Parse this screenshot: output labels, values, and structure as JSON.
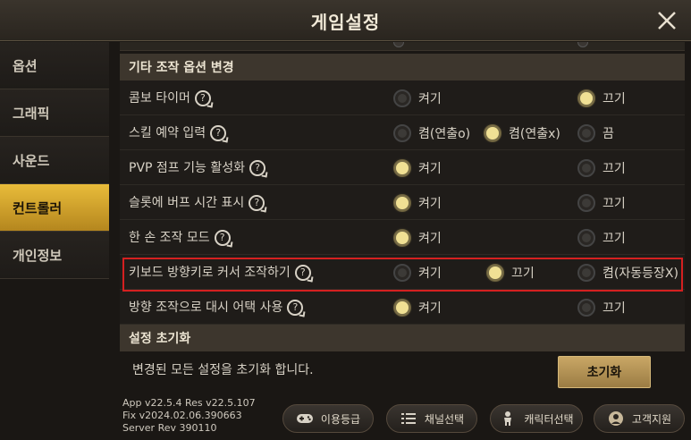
{
  "header": {
    "title": "게임설정"
  },
  "sidebar": {
    "items": [
      {
        "label": "옵션",
        "active": false
      },
      {
        "label": "그래픽",
        "active": false
      },
      {
        "label": "사운드",
        "active": false
      },
      {
        "label": "컨트롤러",
        "active": true
      },
      {
        "label": "개인정보",
        "active": false
      }
    ]
  },
  "sections": {
    "other_controls": "기타 조작 옵션 변경",
    "reset": "설정 초기화"
  },
  "rows": [
    {
      "label": "콤보 타이머",
      "options": [
        {
          "label": "켜기",
          "selected": false
        },
        {
          "label": "끄기",
          "selected": true
        }
      ]
    },
    {
      "label": "스킬 예약 입력",
      "options": [
        {
          "label": "켬(연출o)",
          "selected": false
        },
        {
          "label": "켬(연출x)",
          "selected": true
        },
        {
          "label": "끔",
          "selected": false
        }
      ]
    },
    {
      "label": "PVP 점프 기능 활성화",
      "options": [
        {
          "label": "켜기",
          "selected": true
        },
        {
          "label": "끄기",
          "selected": false
        }
      ]
    },
    {
      "label": "슬롯에 버프 시간 표시",
      "options": [
        {
          "label": "켜기",
          "selected": true
        },
        {
          "label": "끄기",
          "selected": false
        }
      ]
    },
    {
      "label": "한 손 조작 모드",
      "options": [
        {
          "label": "켜기",
          "selected": true
        },
        {
          "label": "끄기",
          "selected": false
        }
      ]
    },
    {
      "label": "키보드 방향키로 커서 조작하기",
      "options": [
        {
          "label": "켜기",
          "selected": false
        },
        {
          "label": "끄기",
          "selected": true
        },
        {
          "label": "켬(자동등장X)",
          "selected": false
        }
      ]
    },
    {
      "label": "방향 조작으로 대시 어택 사용",
      "options": [
        {
          "label": "켜기",
          "selected": true
        },
        {
          "label": "끄기",
          "selected": false
        }
      ]
    }
  ],
  "help_glyph": "?",
  "reset": {
    "description": "변경된 모든 설정을 초기화 합니다.",
    "button": "초기화"
  },
  "version": {
    "line1": "App v22.5.4 Res v22.5.107",
    "line2": "Fix v2024.02.06.390663",
    "line3": "Server Rev 390110"
  },
  "bottom_buttons": [
    {
      "label": "이용등급",
      "icon": "gamepad-icon"
    },
    {
      "label": "채널선택",
      "icon": "list-icon"
    },
    {
      "label": "캐릭터선택",
      "icon": "character-icon"
    },
    {
      "label": "고객지원",
      "icon": "support-icon"
    }
  ],
  "colors": {
    "accent": "#e9bc3a",
    "selected_radio": "#f0e094",
    "highlight_box": "#d42020",
    "reset_button": "#c9a766"
  }
}
